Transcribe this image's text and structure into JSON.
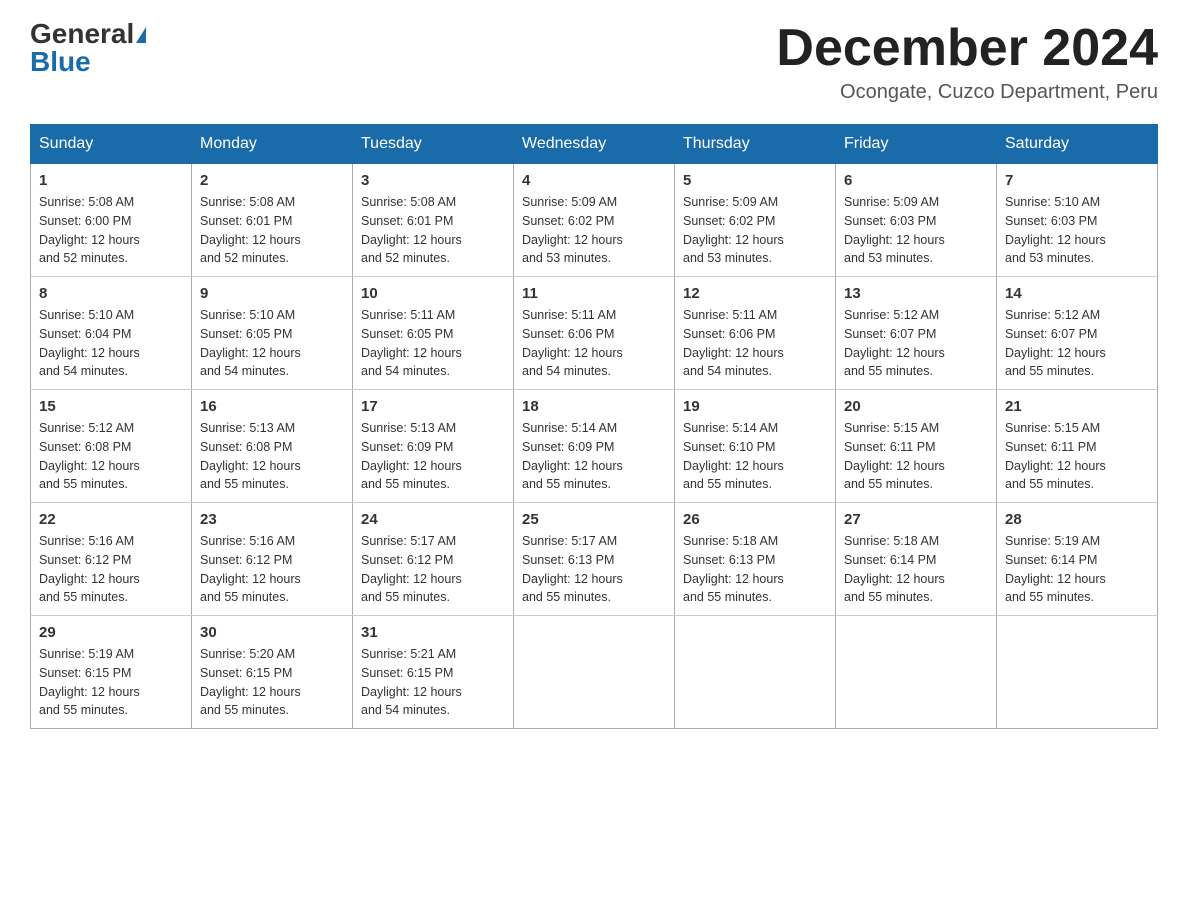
{
  "header": {
    "logo_general": "General",
    "logo_blue": "Blue",
    "month_title": "December 2024",
    "location": "Ocongate, Cuzco Department, Peru"
  },
  "days_of_week": [
    "Sunday",
    "Monday",
    "Tuesday",
    "Wednesday",
    "Thursday",
    "Friday",
    "Saturday"
  ],
  "weeks": [
    [
      {
        "day": "1",
        "sunrise": "5:08 AM",
        "sunset": "6:00 PM",
        "daylight": "12 hours and 52 minutes."
      },
      {
        "day": "2",
        "sunrise": "5:08 AM",
        "sunset": "6:01 PM",
        "daylight": "12 hours and 52 minutes."
      },
      {
        "day": "3",
        "sunrise": "5:08 AM",
        "sunset": "6:01 PM",
        "daylight": "12 hours and 52 minutes."
      },
      {
        "day": "4",
        "sunrise": "5:09 AM",
        "sunset": "6:02 PM",
        "daylight": "12 hours and 53 minutes."
      },
      {
        "day": "5",
        "sunrise": "5:09 AM",
        "sunset": "6:02 PM",
        "daylight": "12 hours and 53 minutes."
      },
      {
        "day": "6",
        "sunrise": "5:09 AM",
        "sunset": "6:03 PM",
        "daylight": "12 hours and 53 minutes."
      },
      {
        "day": "7",
        "sunrise": "5:10 AM",
        "sunset": "6:03 PM",
        "daylight": "12 hours and 53 minutes."
      }
    ],
    [
      {
        "day": "8",
        "sunrise": "5:10 AM",
        "sunset": "6:04 PM",
        "daylight": "12 hours and 54 minutes."
      },
      {
        "day": "9",
        "sunrise": "5:10 AM",
        "sunset": "6:05 PM",
        "daylight": "12 hours and 54 minutes."
      },
      {
        "day": "10",
        "sunrise": "5:11 AM",
        "sunset": "6:05 PM",
        "daylight": "12 hours and 54 minutes."
      },
      {
        "day": "11",
        "sunrise": "5:11 AM",
        "sunset": "6:06 PM",
        "daylight": "12 hours and 54 minutes."
      },
      {
        "day": "12",
        "sunrise": "5:11 AM",
        "sunset": "6:06 PM",
        "daylight": "12 hours and 54 minutes."
      },
      {
        "day": "13",
        "sunrise": "5:12 AM",
        "sunset": "6:07 PM",
        "daylight": "12 hours and 55 minutes."
      },
      {
        "day": "14",
        "sunrise": "5:12 AM",
        "sunset": "6:07 PM",
        "daylight": "12 hours and 55 minutes."
      }
    ],
    [
      {
        "day": "15",
        "sunrise": "5:12 AM",
        "sunset": "6:08 PM",
        "daylight": "12 hours and 55 minutes."
      },
      {
        "day": "16",
        "sunrise": "5:13 AM",
        "sunset": "6:08 PM",
        "daylight": "12 hours and 55 minutes."
      },
      {
        "day": "17",
        "sunrise": "5:13 AM",
        "sunset": "6:09 PM",
        "daylight": "12 hours and 55 minutes."
      },
      {
        "day": "18",
        "sunrise": "5:14 AM",
        "sunset": "6:09 PM",
        "daylight": "12 hours and 55 minutes."
      },
      {
        "day": "19",
        "sunrise": "5:14 AM",
        "sunset": "6:10 PM",
        "daylight": "12 hours and 55 minutes."
      },
      {
        "day": "20",
        "sunrise": "5:15 AM",
        "sunset": "6:11 PM",
        "daylight": "12 hours and 55 minutes."
      },
      {
        "day": "21",
        "sunrise": "5:15 AM",
        "sunset": "6:11 PM",
        "daylight": "12 hours and 55 minutes."
      }
    ],
    [
      {
        "day": "22",
        "sunrise": "5:16 AM",
        "sunset": "6:12 PM",
        "daylight": "12 hours and 55 minutes."
      },
      {
        "day": "23",
        "sunrise": "5:16 AM",
        "sunset": "6:12 PM",
        "daylight": "12 hours and 55 minutes."
      },
      {
        "day": "24",
        "sunrise": "5:17 AM",
        "sunset": "6:12 PM",
        "daylight": "12 hours and 55 minutes."
      },
      {
        "day": "25",
        "sunrise": "5:17 AM",
        "sunset": "6:13 PM",
        "daylight": "12 hours and 55 minutes."
      },
      {
        "day": "26",
        "sunrise": "5:18 AM",
        "sunset": "6:13 PM",
        "daylight": "12 hours and 55 minutes."
      },
      {
        "day": "27",
        "sunrise": "5:18 AM",
        "sunset": "6:14 PM",
        "daylight": "12 hours and 55 minutes."
      },
      {
        "day": "28",
        "sunrise": "5:19 AM",
        "sunset": "6:14 PM",
        "daylight": "12 hours and 55 minutes."
      }
    ],
    [
      {
        "day": "29",
        "sunrise": "5:19 AM",
        "sunset": "6:15 PM",
        "daylight": "12 hours and 55 minutes."
      },
      {
        "day": "30",
        "sunrise": "5:20 AM",
        "sunset": "6:15 PM",
        "daylight": "12 hours and 55 minutes."
      },
      {
        "day": "31",
        "sunrise": "5:21 AM",
        "sunset": "6:15 PM",
        "daylight": "12 hours and 54 minutes."
      },
      null,
      null,
      null,
      null
    ]
  ],
  "labels": {
    "sunrise_prefix": "Sunrise: ",
    "sunset_prefix": "Sunset: ",
    "daylight_prefix": "Daylight: "
  }
}
